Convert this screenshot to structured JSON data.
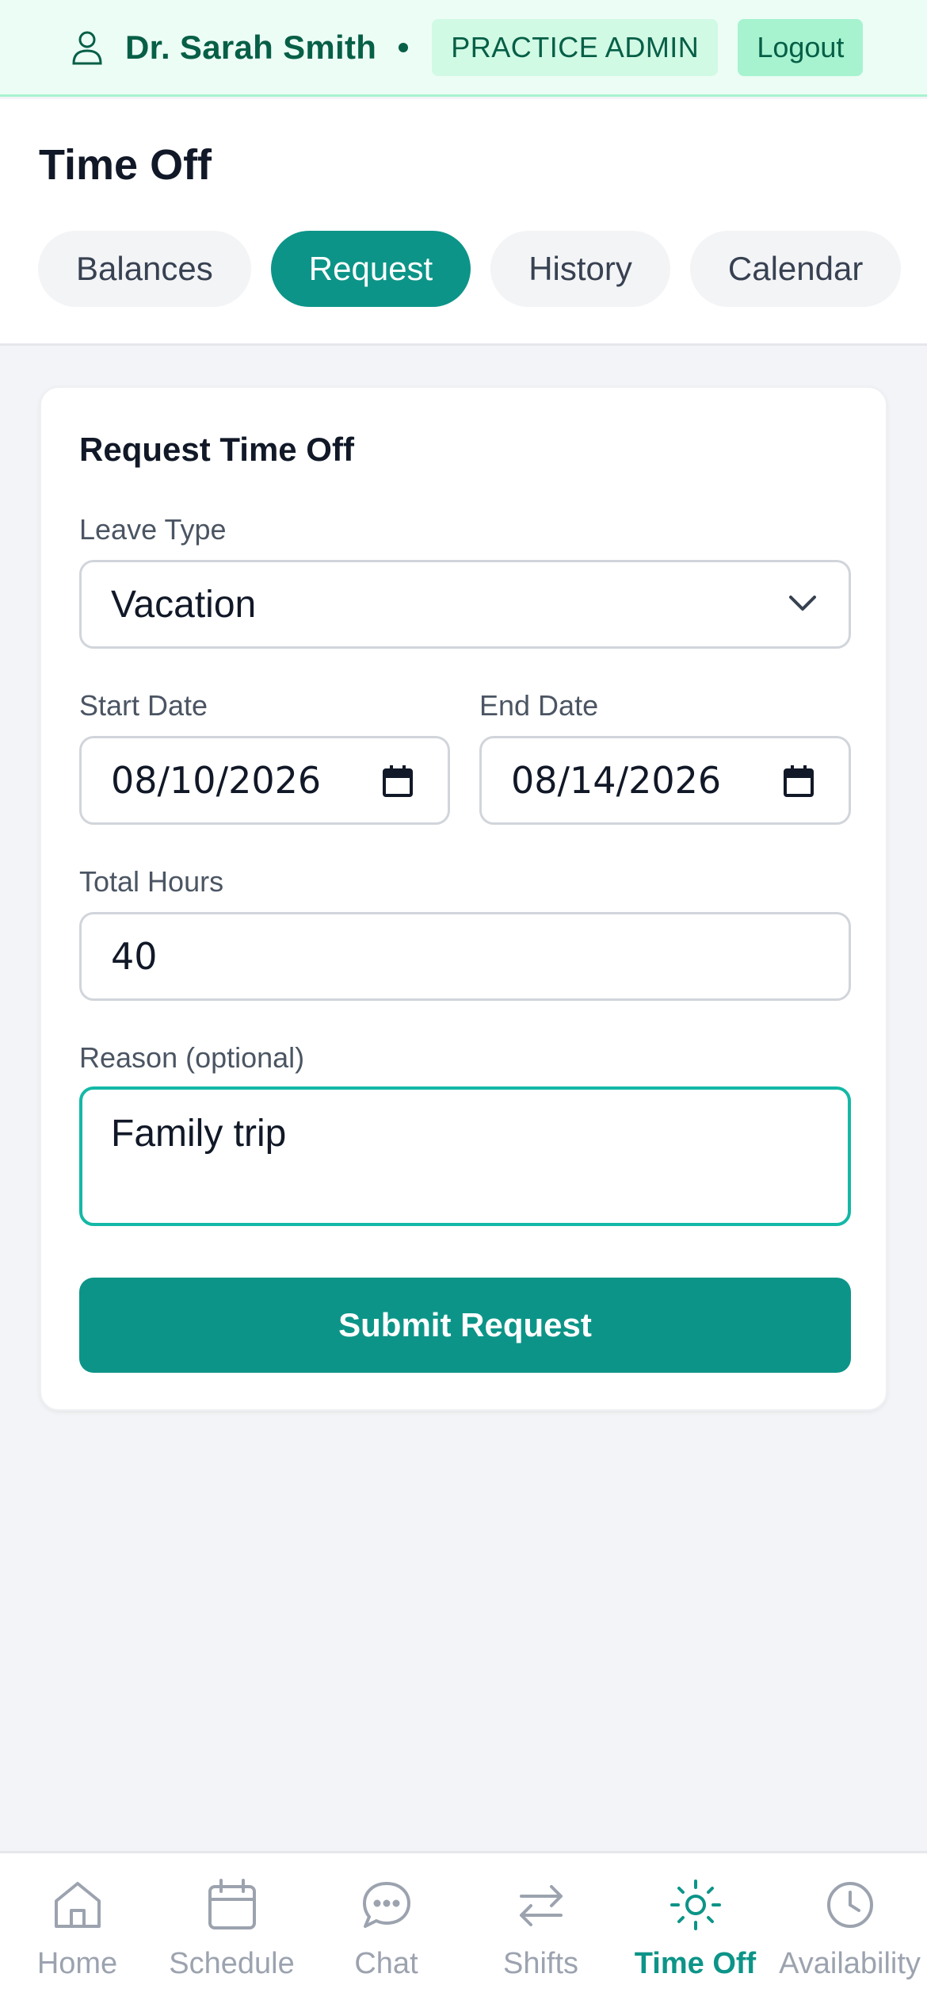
{
  "header": {
    "user_icon": "user-icon",
    "user_name": "Dr. Sarah Smith",
    "role": "PRACTICE ADMIN",
    "logout_label": "Logout"
  },
  "page": {
    "title": "Time Off",
    "tabs": [
      {
        "label": "Balances",
        "active": false
      },
      {
        "label": "Request",
        "active": true
      },
      {
        "label": "History",
        "active": false
      },
      {
        "label": "Calendar",
        "active": false
      }
    ]
  },
  "form": {
    "title": "Request Time Off",
    "leave_type": {
      "label": "Leave Type",
      "value": "Vacation"
    },
    "start_date": {
      "label": "Start Date",
      "value": "08/10/2026"
    },
    "end_date": {
      "label": "End Date",
      "value": "08/14/2026"
    },
    "total_hours": {
      "label": "Total Hours",
      "value": "40"
    },
    "reason": {
      "label": "Reason (optional)",
      "value": "Family trip"
    },
    "submit_label": "Submit Request"
  },
  "nav": {
    "items": [
      {
        "label": "Home",
        "icon": "home-icon",
        "active": false
      },
      {
        "label": "Schedule",
        "icon": "calendar-icon",
        "active": false
      },
      {
        "label": "Chat",
        "icon": "chat-icon",
        "active": false
      },
      {
        "label": "Shifts",
        "icon": "swap-arrows-icon",
        "active": false
      },
      {
        "label": "Time Off",
        "icon": "sun-icon",
        "active": true
      },
      {
        "label": "Availability",
        "icon": "clock-icon",
        "active": false
      }
    ]
  },
  "colors": {
    "accent": "#0d9488",
    "header_bg": "#ecfdf5",
    "header_text": "#065f46"
  }
}
